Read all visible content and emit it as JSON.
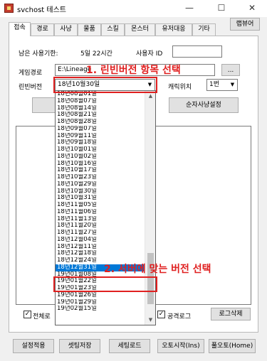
{
  "window": {
    "title": "svchost 테스트",
    "min": "—",
    "max": "☐",
    "close": "✕"
  },
  "tabs": [
    "접속",
    "경로",
    "사냥",
    "물품",
    "스킬",
    "몬스터",
    "유저대응",
    "기타"
  ],
  "favorites_button": "랩뷰어",
  "form": {
    "expiry_label": "남은 사용기한:",
    "expiry_value": "5일 22시간",
    "user_id_label": "사용자 ID",
    "user_id_value": "",
    "game_path_label": "게임경로",
    "game_path_value": "E:\\Lineage",
    "browse_button": "...",
    "version_label": "린빈버전",
    "version_value": "18년10월30일",
    "char_pos_label": "캐릭위치",
    "char_pos_value": "1번",
    "order_button": "순자사냥설정",
    "full_log_label": "전체로",
    "attack_log_label": "공격로그",
    "log_delete_button": "로그삭제"
  },
  "version_options": [
    "18년08월01일",
    "18년08월07일",
    "18년08월14일",
    "18년08월21일",
    "18년08월28일",
    "18년09월07일",
    "18년09월11일",
    "18년09월18일",
    "18년10월01일",
    "18년10월02일",
    "18년10월16일",
    "18년10월17일",
    "18년10월23일",
    "18년10월29일",
    "18년10월30일",
    "18년10월31일",
    "18년11월05일",
    "18년11월06일",
    "18년11월13일",
    "18년11월20일",
    "18년11월27일",
    "18년12월04일",
    "18년12월11일",
    "18년12월18일",
    "18년12월24일",
    "18년12월31일",
    "19년01월08일",
    "19년01월22일",
    "19년01월23일",
    "19년01월26일",
    "19년01월29일",
    "19년02월15일"
  ],
  "selected_option_index": 25,
  "bottom_buttons": [
    "설정적용",
    "셋팅저장",
    "세팅로드",
    "오토시작(Ins)",
    "풀오토(Home)"
  ],
  "annotations": {
    "step1": "1. 린빈버전 항목 선택",
    "step2": "2. 서버에 맞는 버전 선택",
    "color": "#e02020"
  }
}
